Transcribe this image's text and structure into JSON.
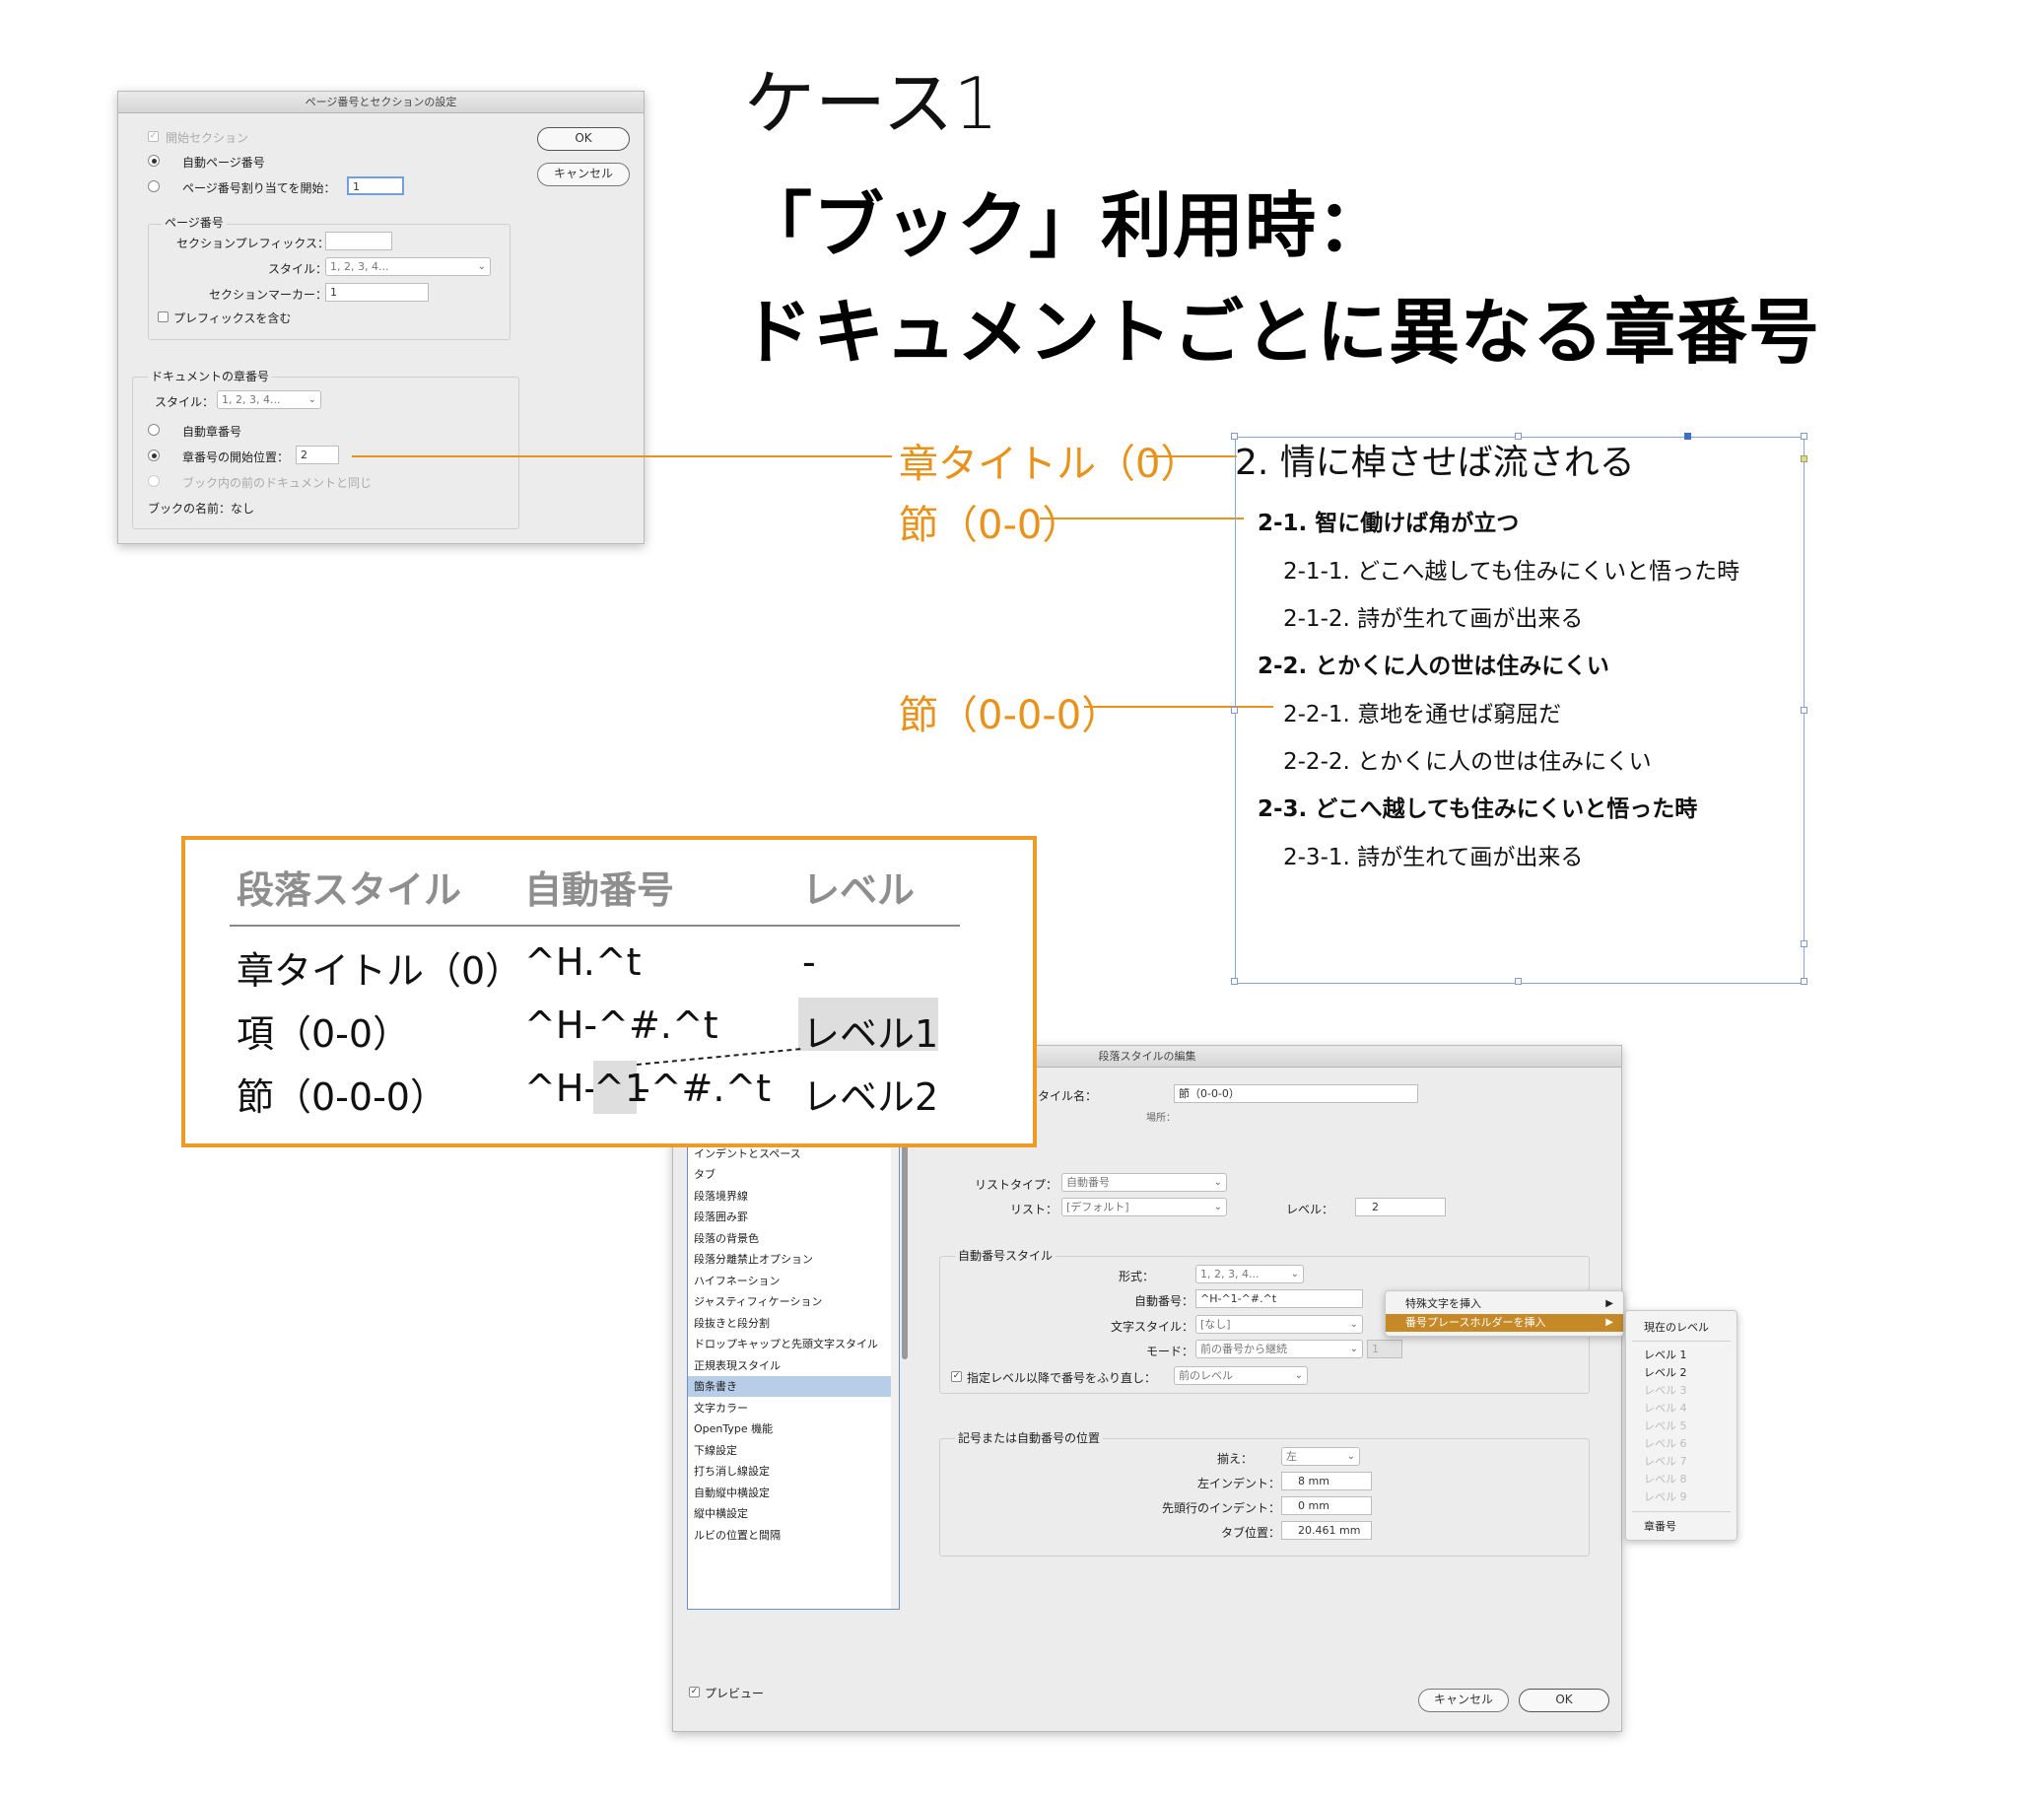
{
  "headings": {
    "case": "ケース1",
    "title_line1": "「ブック」利用時：",
    "title_line2": "ドキュメントごとに異なる章番号"
  },
  "page_section_dialog": {
    "title": "ページ番号とセクションの設定",
    "start_section": "開始セクション",
    "auto_page": "自動ページ番号",
    "start_page_label": "ページ番号割り当てを開始：",
    "start_page_value": "1",
    "page_number_group": "ページ番号",
    "section_prefix_label": "セクションプレフィックス：",
    "section_prefix_value": "",
    "style_label": "スタイル：",
    "style_value": "1, 2, 3, 4...",
    "section_marker_label": "セクションマーカー：",
    "section_marker_value": "1",
    "include_prefix": "プレフィックスを含む",
    "doc_chapter_group": "ドキュメントの章番号",
    "chapter_style_label": "スタイル：",
    "chapter_style_value": "1, 2, 3, 4...",
    "auto_chapter": "自動章番号",
    "chapter_start_label": "章番号の開始位置：",
    "chapter_start_value": "2",
    "same_as_prev": "ブック内の前のドキュメントと同じ",
    "book_name": "ブックの名前：なし",
    "ok": "OK",
    "cancel": "キャンセル"
  },
  "callouts": {
    "chapter": "章タイトル（0）",
    "section": "節（0-0）",
    "subsection": "節（0-0-0）"
  },
  "sample": {
    "chapter": "2. 情に棹させば流される",
    "items": [
      {
        "text": "2-1.  智に働けば角が立つ",
        "level": 1
      },
      {
        "text": "2-1-1.  どこへ越しても住みにくいと悟った時",
        "level": 2
      },
      {
        "text": "2-1-2.  詩が生れて画が出来る",
        "level": 2
      },
      {
        "text": "2-2.  とかくに人の世は住みにくい",
        "level": 1
      },
      {
        "text": "2-2-1.  意地を通せば窮屈だ",
        "level": 2
      },
      {
        "text": "2-2-2.  とかくに人の世は住みにくい",
        "level": 2
      },
      {
        "text": "2-3.  どこへ越しても住みにくいと悟った時",
        "level": 1
      },
      {
        "text": "2-3-1.  詩が生れて画が出来る",
        "level": 2
      }
    ]
  },
  "table": {
    "headers": [
      "段落スタイル",
      "自動番号",
      "レベル"
    ],
    "rows": [
      {
        "style": "章タイトル（0）",
        "number": "^H.^t",
        "level": "-"
      },
      {
        "style": "項（0-0）",
        "number": "^H-^#.^t",
        "level": "レベル1"
      },
      {
        "style": "節（0-0-0）",
        "number_a": "^H-",
        "number_b": "^1",
        "number_c": "-^#.^t",
        "level": "レベル2"
      }
    ]
  },
  "para_dialog": {
    "title": "段落スタイルの編集",
    "style_name_label": "スタイル名：",
    "style_name_value": "節（0-0-0）",
    "location_label": "場所：",
    "categories": [
      "インデントとスペース",
      "タブ",
      "段落境界線",
      "段落囲み罫",
      "段落の背景色",
      "段落分離禁止オプション",
      "ハイフネーション",
      "ジャスティフィケーション",
      "段抜きと段分割",
      "ドロップキャップと先頭文字スタイル",
      "正規表現スタイル",
      "箇条書き",
      "文字カラー",
      "OpenType 機能",
      "下線設定",
      "打ち消し線設定",
      "自動縦中横設定",
      "縦中横設定",
      "ルビの位置と間隔"
    ],
    "selected_category": "箇条書き",
    "list_type_label": "リストタイプ：",
    "list_type_value": "自動番号",
    "list_label": "リスト：",
    "list_value": "[デフォルト]",
    "level_label": "レベル：",
    "level_value": "2",
    "numbering_style_group": "自動番号スタイル",
    "format_label": "形式：",
    "format_value": "1, 2, 3, 4...",
    "number_label": "自動番号：",
    "number_value": "^H-^1-^#.^t",
    "char_style_label": "文字スタイル：",
    "char_style_value": "[なし]",
    "mode_label": "モード：",
    "mode_value": "前の番号から継続",
    "mode_num": "1",
    "restart_label": "指定レベル以降で番号をふり直し：",
    "restart_value": "前のレベル",
    "position_group": "記号または自動番号の位置",
    "align_label": "揃え：",
    "align_value": "左",
    "left_indent_label": "左インデント：",
    "left_indent_value": "8 mm",
    "first_indent_label": "先頭行のインデント：",
    "first_indent_value": "0 mm",
    "tab_label": "タブ位置：",
    "tab_value": "20.461 mm",
    "preview": "プレビュー",
    "cancel": "キャンセル",
    "ok": "OK",
    "menu_special": "特殊文字を挿入",
    "menu_placeholder": "番号プレースホルダーを挿入",
    "submenu": {
      "current": "現在のレベル",
      "levels": [
        "レベル 1",
        "レベル 2",
        "レベル 3",
        "レベル 4",
        "レベル 5",
        "レベル 6",
        "レベル 7",
        "レベル 8",
        "レベル 9"
      ],
      "chapter": "章番号"
    }
  },
  "colors": {
    "accent": "#ef9a24",
    "callout": "#e8921b",
    "menu_highlight": "#c58928",
    "frame": "#8aa6d6"
  }
}
